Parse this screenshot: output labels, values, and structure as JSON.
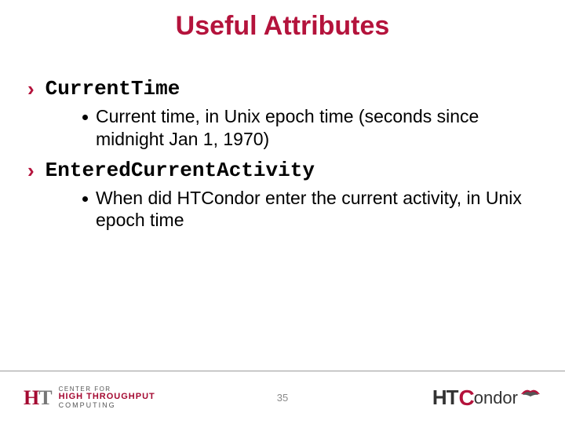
{
  "title": "Useful Attributes",
  "items": [
    {
      "name": "CurrentTime",
      "desc": "Current time, in Unix epoch time (seconds since midnight Jan 1, 1970)"
    },
    {
      "name": "EnteredCurrentActivity",
      "desc": "When did HTCondor enter the current activity, in Unix epoch time"
    }
  ],
  "footer": {
    "left_logo": {
      "line1": "CENTER FOR",
      "line2": "HIGH THROUGHPUT",
      "line3": "COMPUTING"
    },
    "page_number": "35",
    "right_logo": {
      "prefix": "HT",
      "c": "C",
      "rest": "ondor"
    }
  }
}
